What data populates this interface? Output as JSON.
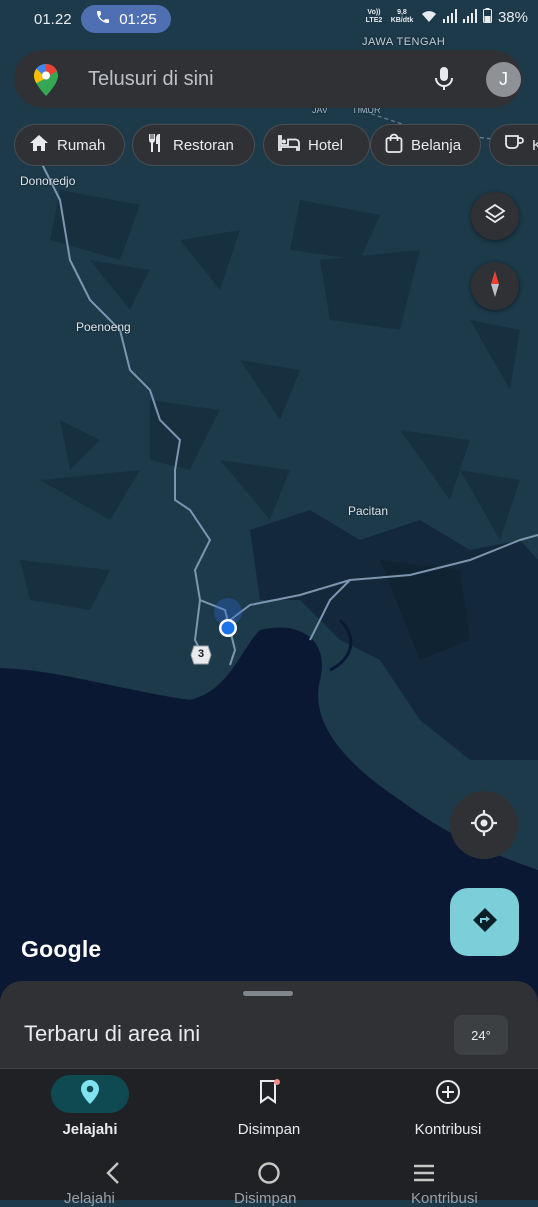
{
  "status_bar": {
    "time": "01.22",
    "call_duration": "01:25",
    "net_top": "Vo)) LTE2",
    "net_speed": "9,8 KB/dtk",
    "battery": "38%"
  },
  "search": {
    "placeholder": "Telusuri di sini",
    "avatar_initial": "J"
  },
  "chips": [
    {
      "label": "Rumah",
      "icon": "home-icon"
    },
    {
      "label": "Restoran",
      "icon": "restaurant-icon"
    },
    {
      "label": "Hotel",
      "icon": "hotel-icon"
    },
    {
      "label": "Belanja",
      "icon": "shopping-bag-icon"
    },
    {
      "label": "K",
      "icon": "coffee-icon"
    }
  ],
  "map": {
    "places": {
      "donoredjo": "Donoredjo",
      "poenoeng": "Poenoeng",
      "pacitan": "Pacitan",
      "province": "JAWA TENGAH",
      "road_label_1": "JAV",
      "road_label_2": "TIMUR"
    },
    "route_shield": "3",
    "logo": "Google",
    "colors": {
      "land": "#1c3a4a",
      "sea": "#0b1834",
      "roads": "#7d95b0",
      "location_dot": "#1a73e8"
    }
  },
  "sheet": {
    "title": "Terbaru di area ini",
    "weather": "24°"
  },
  "bottom_nav": {
    "explore": "Jelajahi",
    "saved": "Disimpan",
    "contribute": "Kontribusi"
  },
  "system_nav": {
    "ghost_explore": "Jelajahi",
    "ghost_saved": "Disimpan",
    "ghost_contribute": "Kontribusi"
  }
}
